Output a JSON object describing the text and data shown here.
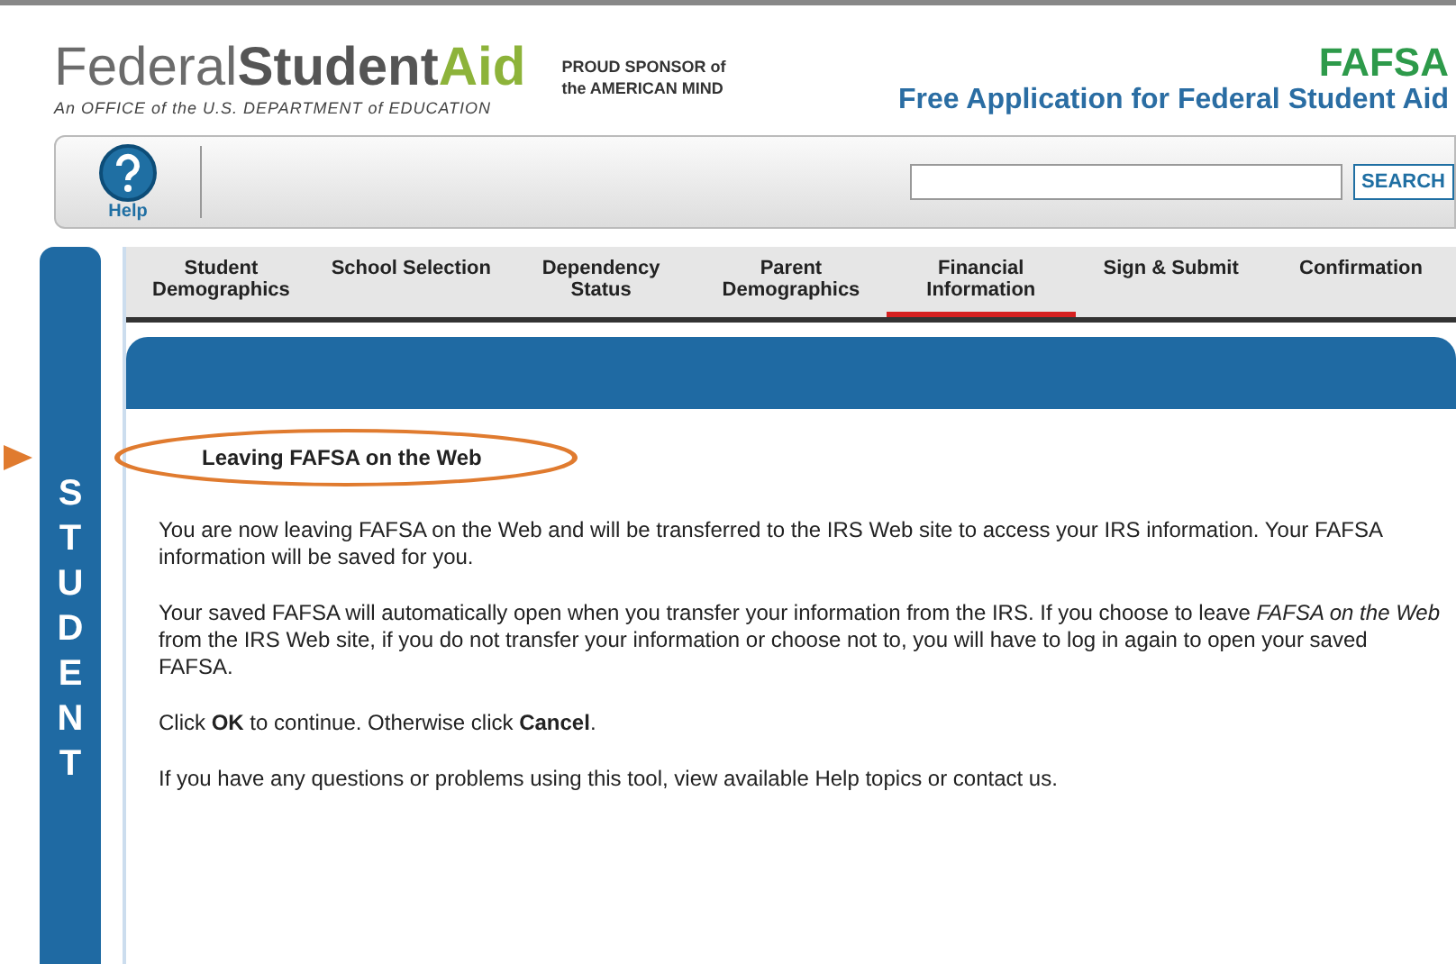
{
  "header": {
    "logo_words": [
      "Federal",
      "Student",
      "Aid"
    ],
    "logo_tagline": "An OFFICE of the U.S. DEPARTMENT of EDUCATION",
    "sponsor": [
      "PROUD SPONSOR of",
      "the AMERICAN MIND"
    ],
    "fafsa_logo": "FAFSA",
    "site_title": "Free Application for Federal Student Aid"
  },
  "toolbar": {
    "help": "Help",
    "search_button": "SEARCH"
  },
  "tabs": [
    {
      "label": "Student Demographics",
      "selected": false
    },
    {
      "label": "School Selection",
      "selected": false
    },
    {
      "label": "Dependency Status",
      "selected": false
    },
    {
      "label": "Parent Demographics",
      "selected": false
    },
    {
      "label": "Financial Information",
      "selected": true
    },
    {
      "label": "Sign & Submit",
      "selected": false
    },
    {
      "label": "Confirmation",
      "selected": false
    }
  ],
  "side_label": "STUDENT",
  "heading": "Leaving FAFSA on the Web",
  "paragraphs": [
    "You are now leaving FAFSA on the Web and will be transferred to the IRS Web site to access your IRS information. Your FAFSA information will be saved for you.",
    "Your saved FAFSA will automatically open when you transfer your information from the IRS. If you choose to leave *FAFSA on the Web* from the IRS Web site, if you do not transfer your information or choose not to, you will have to log in again to open your saved FAFSA.",
    "Click **OK** to continue. Otherwise click **Cancel**.",
    "If you have any questions or problems using this tool, view available Help topics or contact us."
  ]
}
